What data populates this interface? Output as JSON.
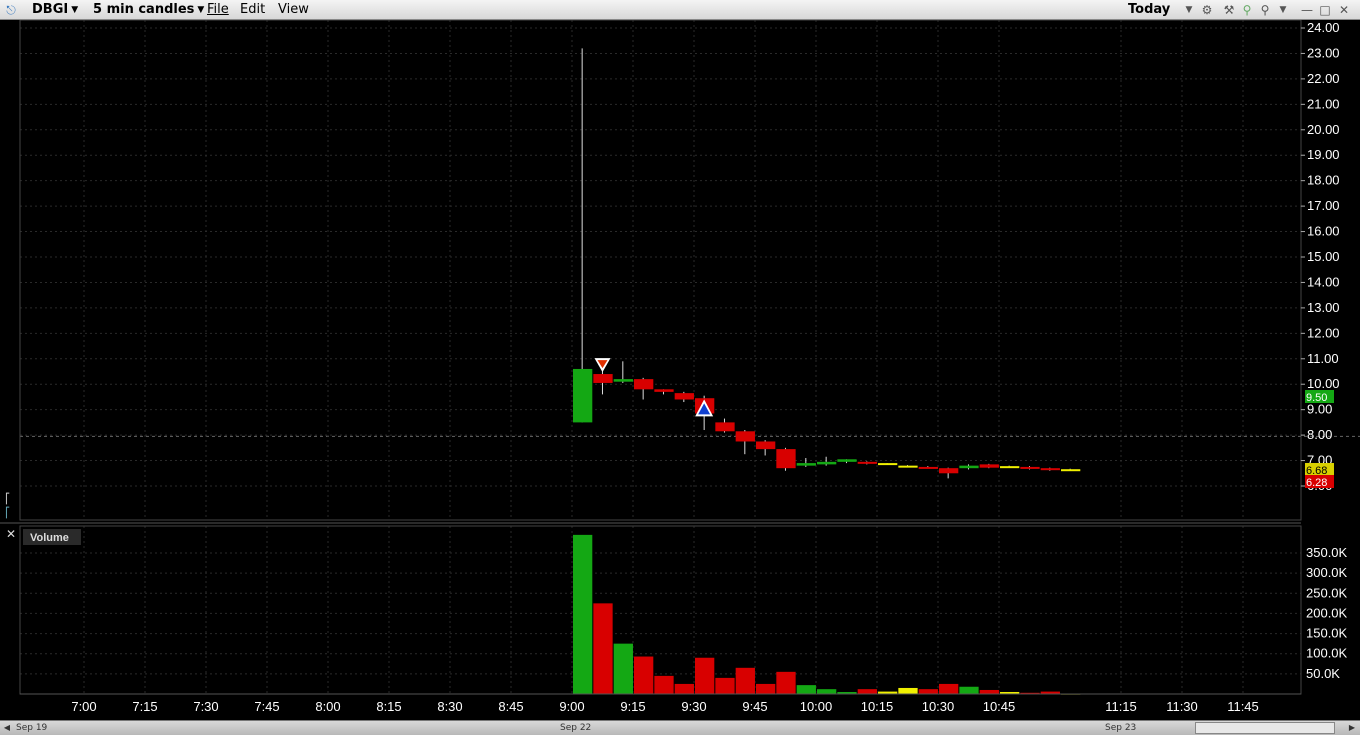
{
  "toolbar": {
    "symbol": "DBGI",
    "interval": "5 min candles",
    "menu_file": "File",
    "menu_edit": "Edit",
    "menu_view": "View",
    "range": "Today"
  },
  "volume_panel_label": "Volume",
  "price_tags": {
    "high_tag": "9.50",
    "last_tag": "6.68",
    "low_tag": "6.28"
  },
  "dates": {
    "left": "Sep 19",
    "mid": "Sep 22",
    "right": "Sep 23"
  },
  "colors": {
    "up": "#14a814",
    "down": "#d80000",
    "neutral": "#f0f000",
    "grid": "#2a2a2a",
    "axis": "#ffffff"
  },
  "chart_data": {
    "type": "candlestick",
    "x_ticks": [
      "7:00",
      "7:15",
      "7:30",
      "7:45",
      "8:00",
      "8:15",
      "8:30",
      "8:45",
      "9:00",
      "9:15",
      "9:30",
      "9:45",
      "10:00",
      "10:15",
      "10:30",
      "10:45",
      "11:15",
      "11:30",
      "11:45"
    ],
    "y_ticks": [
      "24.00",
      "23.00",
      "22.00",
      "21.00",
      "20.00",
      "19.00",
      "18.00",
      "17.00",
      "16.00",
      "15.00",
      "14.00",
      "13.00",
      "12.00",
      "11.00",
      "10.00",
      "9.00",
      "8.00",
      "7.00",
      "6.00"
    ],
    "ylim": [
      5.5,
      24.4
    ],
    "volume_ticks": [
      "350.0K",
      "300.0K",
      "250.0K",
      "200.0K",
      "150.0K",
      "100.0K",
      "50.0K"
    ],
    "candles": [
      {
        "t": "9:00",
        "o": 8.5,
        "h": 23.2,
        "l": 8.5,
        "c": 10.6,
        "v": 395000,
        "vc": "up"
      },
      {
        "t": "9:05",
        "o": 10.4,
        "h": 10.7,
        "l": 9.6,
        "c": 10.05,
        "v": 225000,
        "vc": "down"
      },
      {
        "t": "9:10",
        "o": 10.1,
        "h": 10.9,
        "l": 10.05,
        "c": 10.2,
        "v": 125000,
        "vc": "up"
      },
      {
        "t": "9:15",
        "o": 10.2,
        "h": 10.25,
        "l": 9.4,
        "c": 9.8,
        "v": 93000,
        "vc": "down"
      },
      {
        "t": "9:20",
        "o": 9.8,
        "h": 9.8,
        "l": 9.6,
        "c": 9.7,
        "v": 45000,
        "vc": "down"
      },
      {
        "t": "9:25",
        "o": 9.65,
        "h": 9.7,
        "l": 9.3,
        "c": 9.4,
        "v": 25000,
        "vc": "down"
      },
      {
        "t": "9:30",
        "o": 9.45,
        "h": 9.55,
        "l": 8.2,
        "c": 8.85,
        "v": 90000,
        "vc": "down"
      },
      {
        "t": "9:35",
        "o": 8.5,
        "h": 8.65,
        "l": 8.1,
        "c": 8.15,
        "v": 40000,
        "vc": "down"
      },
      {
        "t": "9:40",
        "o": 8.15,
        "h": 8.2,
        "l": 7.25,
        "c": 7.75,
        "v": 65000,
        "vc": "down"
      },
      {
        "t": "9:45",
        "o": 7.75,
        "h": 7.8,
        "l": 7.2,
        "c": 7.45,
        "v": 25000,
        "vc": "down"
      },
      {
        "t": "9:50",
        "o": 7.45,
        "h": 7.5,
        "l": 6.6,
        "c": 6.7,
        "v": 55000,
        "vc": "down"
      },
      {
        "t": "9:55",
        "o": 6.8,
        "h": 7.1,
        "l": 6.75,
        "c": 6.9,
        "v": 22000,
        "vc": "up"
      },
      {
        "t": "10:00",
        "o": 6.85,
        "h": 7.15,
        "l": 6.8,
        "c": 6.95,
        "v": 12000,
        "vc": "up"
      },
      {
        "t": "10:05",
        "o": 6.95,
        "h": 7.05,
        "l": 6.9,
        "c": 7.05,
        "v": 5000,
        "vc": "up"
      },
      {
        "t": "10:10",
        "o": 6.95,
        "h": 6.97,
        "l": 6.85,
        "c": 6.88,
        "v": 12000,
        "vc": "down"
      },
      {
        "t": "10:15",
        "o": 6.9,
        "h": 6.9,
        "l": 6.85,
        "c": 6.88,
        "v": 6000,
        "vc": "neutral"
      },
      {
        "t": "10:20",
        "o": 6.8,
        "h": 6.82,
        "l": 6.78,
        "c": 6.8,
        "v": 15000,
        "vc": "neutral"
      },
      {
        "t": "10:25",
        "o": 6.75,
        "h": 6.78,
        "l": 6.7,
        "c": 6.72,
        "v": 12000,
        "vc": "down"
      },
      {
        "t": "10:30",
        "o": 6.7,
        "h": 6.72,
        "l": 6.3,
        "c": 6.5,
        "v": 25000,
        "vc": "down"
      },
      {
        "t": "10:35",
        "o": 6.7,
        "h": 6.85,
        "l": 6.65,
        "c": 6.8,
        "v": 18000,
        "vc": "up"
      },
      {
        "t": "10:40",
        "o": 6.85,
        "h": 6.87,
        "l": 6.7,
        "c": 6.72,
        "v": 10000,
        "vc": "down"
      },
      {
        "t": "10:45",
        "o": 6.78,
        "h": 6.8,
        "l": 6.75,
        "c": 6.78,
        "v": 5000,
        "vc": "neutral"
      },
      {
        "t": "10:50",
        "o": 6.75,
        "h": 6.78,
        "l": 6.65,
        "c": 6.7,
        "v": 3000,
        "vc": "down"
      },
      {
        "t": "10:55",
        "o": 6.7,
        "h": 6.72,
        "l": 6.6,
        "c": 6.65,
        "v": 6000,
        "vc": "down"
      },
      {
        "t": "11:00",
        "o": 6.66,
        "h": 6.68,
        "l": 6.64,
        "c": 6.66,
        "v": 1000,
        "vc": "neutral"
      }
    ],
    "markers": [
      {
        "type": "sell",
        "t": "9:05",
        "price": 10.75
      },
      {
        "type": "buy",
        "t": "9:30",
        "price": 9.05
      }
    ],
    "reference_line": 7.95
  }
}
